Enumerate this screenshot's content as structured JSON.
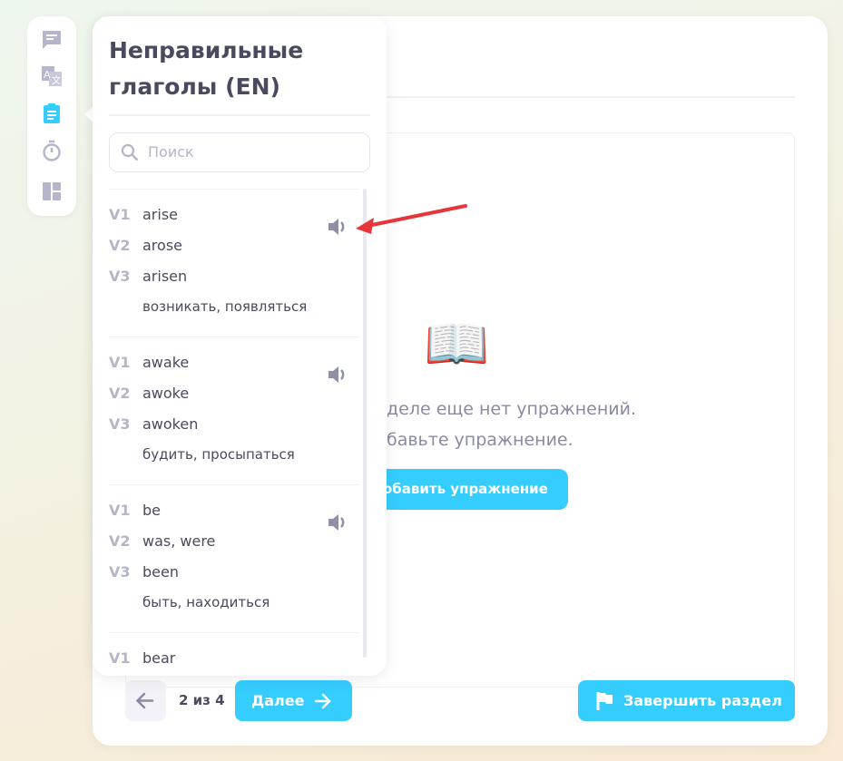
{
  "rail": {
    "icons": [
      "chat-icon",
      "translate-icon",
      "clipboard-icon",
      "timer-icon",
      "layout-icon"
    ],
    "active_color": "#35cdfe"
  },
  "panel": {
    "title": "Неправильные глаголы (EN)",
    "search_placeholder": "Поиск",
    "entries": [
      {
        "v1": "arise",
        "v2": "arose",
        "v3": "arisen",
        "translation": "возникать, появляться"
      },
      {
        "v1": "awake",
        "v2": "awoke",
        "v3": "awoken",
        "translation": "будить, просыпаться"
      },
      {
        "v1": "be",
        "v2": "was, were",
        "v3": "been",
        "translation": "быть, находиться"
      },
      {
        "v1": "bear"
      }
    ],
    "labels": {
      "v1": "V1",
      "v2": "V2",
      "v3": "V3"
    }
  },
  "main": {
    "empty_line1": "деле еще нет упражнений.",
    "empty_line2": "бавьте упражнение.",
    "add_button": "обавить упражнение"
  },
  "footer": {
    "page": "2 из 4",
    "next": "Далее",
    "finish": "Завершить раздел"
  },
  "colors": {
    "accent": "#35cdfe",
    "annotation": "#e8353a"
  }
}
